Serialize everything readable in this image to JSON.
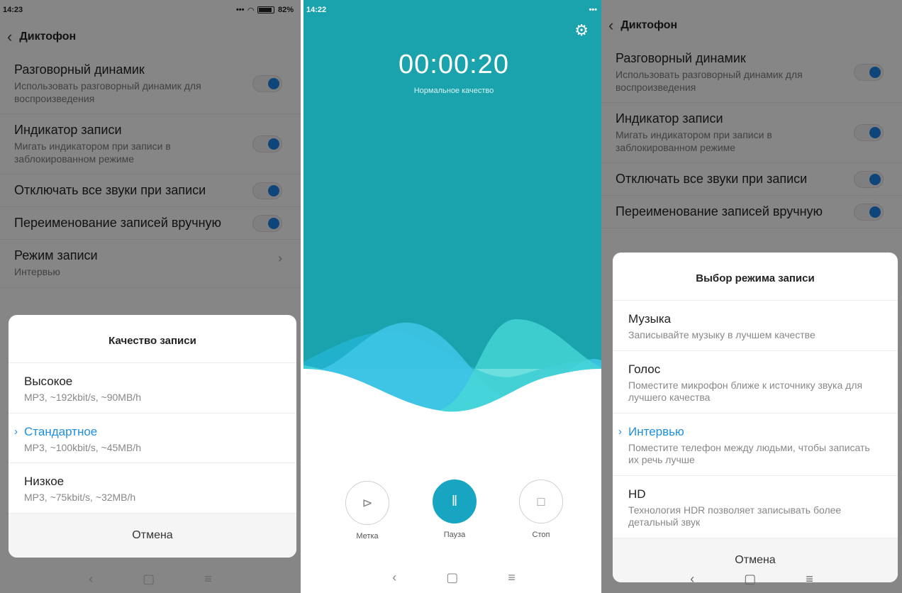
{
  "left": {
    "status": {
      "time": "14:23",
      "battery": "82%"
    },
    "app_title": "Диктофон",
    "settings": [
      {
        "title": "Разговорный динамик",
        "sub": "Использовать разговорный динамик для воспроизведения"
      },
      {
        "title": "Индикатор записи",
        "sub": "Мигать индикатором при записи в заблокированном режиме"
      },
      {
        "title": "Отключать все звуки при записи"
      },
      {
        "title": "Переименование записей вручную"
      },
      {
        "title": "Режим записи",
        "sub": "Интервью"
      }
    ],
    "sheet": {
      "title": "Качество записи",
      "options": [
        {
          "title": "Высокое",
          "sub": "MP3, ~192kbit/s, ~90MB/h"
        },
        {
          "title": "Стандартное",
          "sub": "MP3, ~100kbit/s, ~45MB/h"
        },
        {
          "title": "Низкое",
          "sub": "MP3, ~75kbit/s, ~32MB/h"
        }
      ],
      "cancel": "Отмена"
    }
  },
  "middle": {
    "status": {
      "time": "14:22"
    },
    "timer": "00:00:20",
    "quality": "Нормальное качество",
    "controls": {
      "mark": "Метка",
      "pause": "Пауза",
      "stop": "Стоп"
    }
  },
  "right": {
    "app_title": "Диктофон",
    "settings": [
      {
        "title": "Разговорный динамик",
        "sub": "Использовать разговорный динамик для воспроизведения"
      },
      {
        "title": "Индикатор записи",
        "sub": "Мигать индикатором при записи в заблокированном режиме"
      },
      {
        "title": "Отключать все звуки при записи"
      },
      {
        "title": "Переименование записей вручную"
      }
    ],
    "sheet": {
      "title": "Выбор режима записи",
      "options": [
        {
          "title": "Музыка",
          "sub": "Записывайте музыку в лучшем качестве"
        },
        {
          "title": "Голос",
          "sub": "Поместите микрофон ближе к источнику звука для лучшего качества"
        },
        {
          "title": "Интервью",
          "sub": "Поместите телефон между людьми, чтобы записать их речь лучше"
        },
        {
          "title": "HD",
          "sub": "Технология HDR позволяет записывать более детальный звук"
        }
      ],
      "cancel": "Отмена"
    }
  },
  "colors": {
    "accent": "#1d8fe0",
    "recorder_bg": "#1aa3ad"
  }
}
